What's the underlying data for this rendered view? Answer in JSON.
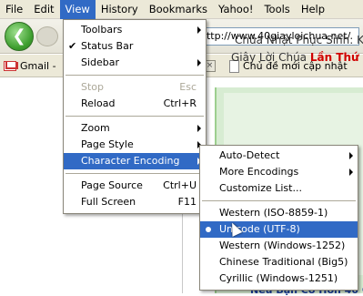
{
  "menubar": {
    "items": [
      {
        "label": "File"
      },
      {
        "label": "Edit"
      },
      {
        "label": "View"
      },
      {
        "label": "History"
      },
      {
        "label": "Bookmarks"
      },
      {
        "label": "Yahoo!"
      },
      {
        "label": "Tools"
      },
      {
        "label": "Help"
      }
    ]
  },
  "navbar": {
    "url": "http://www.40giayloichua.net/"
  },
  "bookmarks": {
    "gmail": "Gmail -",
    "chu": "Chủ đề mới cập nhật"
  },
  "page": {
    "headline1": "Chúa Nhật Phục Sinh: Kỹ",
    "headline2_prefix": "Giây Lời Chúa ",
    "headline2_red": "Lần Thứ",
    "bottom": "Nếu Bạn Có Hơn 40 Gi"
  },
  "view_menu": {
    "toolbars": "Toolbars",
    "status_bar": "Status Bar",
    "sidebar": "Sidebar",
    "stop": "Stop",
    "stop_acc": "Esc",
    "reload": "Reload",
    "reload_acc": "Ctrl+R",
    "zoom": "Zoom",
    "page_style": "Page Style",
    "character_encoding": "Character Encoding",
    "page_source": "Page Source",
    "page_source_acc": "Ctrl+U",
    "full_screen": "Full Screen",
    "full_screen_acc": "F11"
  },
  "encoding_menu": {
    "auto_detect": "Auto-Detect",
    "more_encodings": "More Encodings",
    "customize": "Customize List...",
    "western_iso": "Western (ISO-8859-1)",
    "unicode": "Unicode (UTF-8)",
    "western_win": "Western (Windows-1252)",
    "chinese": "Chinese Traditional (Big5)",
    "cyrillic": "Cyrillic (Windows-1251)"
  },
  "colors": {
    "highlight": "#316ac5",
    "menubar_bg": "#ece9d8",
    "page_red": "#d00000",
    "page_blue": "#1a3c9a"
  }
}
